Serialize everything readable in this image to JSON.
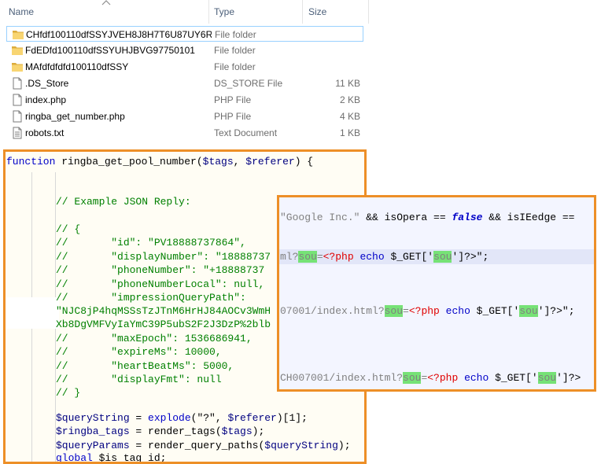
{
  "columns": {
    "name": "Name",
    "type": "Type",
    "size": "Size"
  },
  "files": [
    {
      "name": "CHfdf100110dfSSYJVEH8J8H7T6U87UY6R...",
      "type": "File folder",
      "size": "",
      "icon": "folder-icon"
    },
    {
      "name": "FdEDfd100110dfSSYUHJBVG97750101",
      "type": "File folder",
      "size": "",
      "icon": "folder-icon"
    },
    {
      "name": "MAfdfdfdfd100110dfSSY",
      "type": "File folder",
      "size": "",
      "icon": "folder-icon"
    },
    {
      "name": ".DS_Store",
      "type": "DS_STORE File",
      "size": "11 KB",
      "icon": "file-icon"
    },
    {
      "name": "index.php",
      "type": "PHP File",
      "size": "2 KB",
      "icon": "file-icon"
    },
    {
      "name": "ringba_get_number.php",
      "type": "PHP File",
      "size": "4 KB",
      "icon": "file-icon"
    },
    {
      "name": "robots.txt",
      "type": "Text Document",
      "size": "1 KB",
      "icon": "text-file-icon"
    }
  ],
  "code_main": {
    "l1_kw": "function",
    "l1_fn": " ringba_get_pool_number(",
    "l1_var1": "$tags",
    "l1_comma": ", ",
    "l1_var2": "$referer",
    "l1_close": ") {",
    "c1": "// Example JSON Reply:",
    "c2": "// {",
    "c3": "//       \"id\": \"PV18888737864\",",
    "c4": "//       \"displayNumber\": \"18888737",
    "c5": "//       \"phoneNumber\": \"+18888737",
    "c6": "//       \"phoneNumberLocal\": null,",
    "c7": "//       \"impressionQueryPath\":",
    "c8": "\"NJC8jP4hqMSSsTzJTnM6HrHJ84AOCv3WmH",
    "c9": "Xb8DgVMFVyIaYmC39P5ubS2F2J3DzP%2blb",
    "c10": "//       \"maxEpoch\": 1536686941,",
    "c11": "//       \"expireMs\": 10000,",
    "c12": "//       \"heartBeatMs\": 5000,",
    "c13": "//       \"displayFmt\": null",
    "c14": "// }",
    "q_var": "$queryString",
    "q_eq": " = ",
    "q_fn": "explode",
    "q_args1": "(\"?\", ",
    "q_ref": "$referer",
    "q_args2": ")[1];",
    "t_var": "$ringba_tags",
    "t_rest": " = render_tags(",
    "t_arg": "$tags",
    "t_end": ");",
    "p_var": "$queryParams",
    "p_rest": " = render_query_paths(",
    "p_arg": "$queryString",
    "p_end": ");",
    "g_kw": "global",
    "g_var": " $is_tag_id;"
  },
  "code_overlay": {
    "a_str": "\"Google Inc.\"",
    "a_op1": " && isOpera == ",
    "a_false": "false",
    "a_op2": " && isIEedge ==",
    "b_pre": "ml?",
    "b_sou": "sou",
    "b_eq": "=",
    "b_php": "<?php",
    "b_echo": " echo ",
    "b_get": "$_GET['",
    "b_sou2": "sou",
    "b_end": "']?>\";",
    "c_pre": "07001/index.html?",
    "c_sou": "sou",
    "c_eq": "=",
    "c_php": "<?php",
    "c_echo": " echo ",
    "c_get": "$_GET['",
    "c_sou2": "sou",
    "c_end": "']?>\";",
    "d_pre": "CH007001/index.html?",
    "d_sou": "sou",
    "d_eq": "=",
    "d_php": "<?php",
    "d_echo": " echo ",
    "d_get": "$_GET['",
    "d_sou2": "sou",
    "d_end": "']?>"
  }
}
